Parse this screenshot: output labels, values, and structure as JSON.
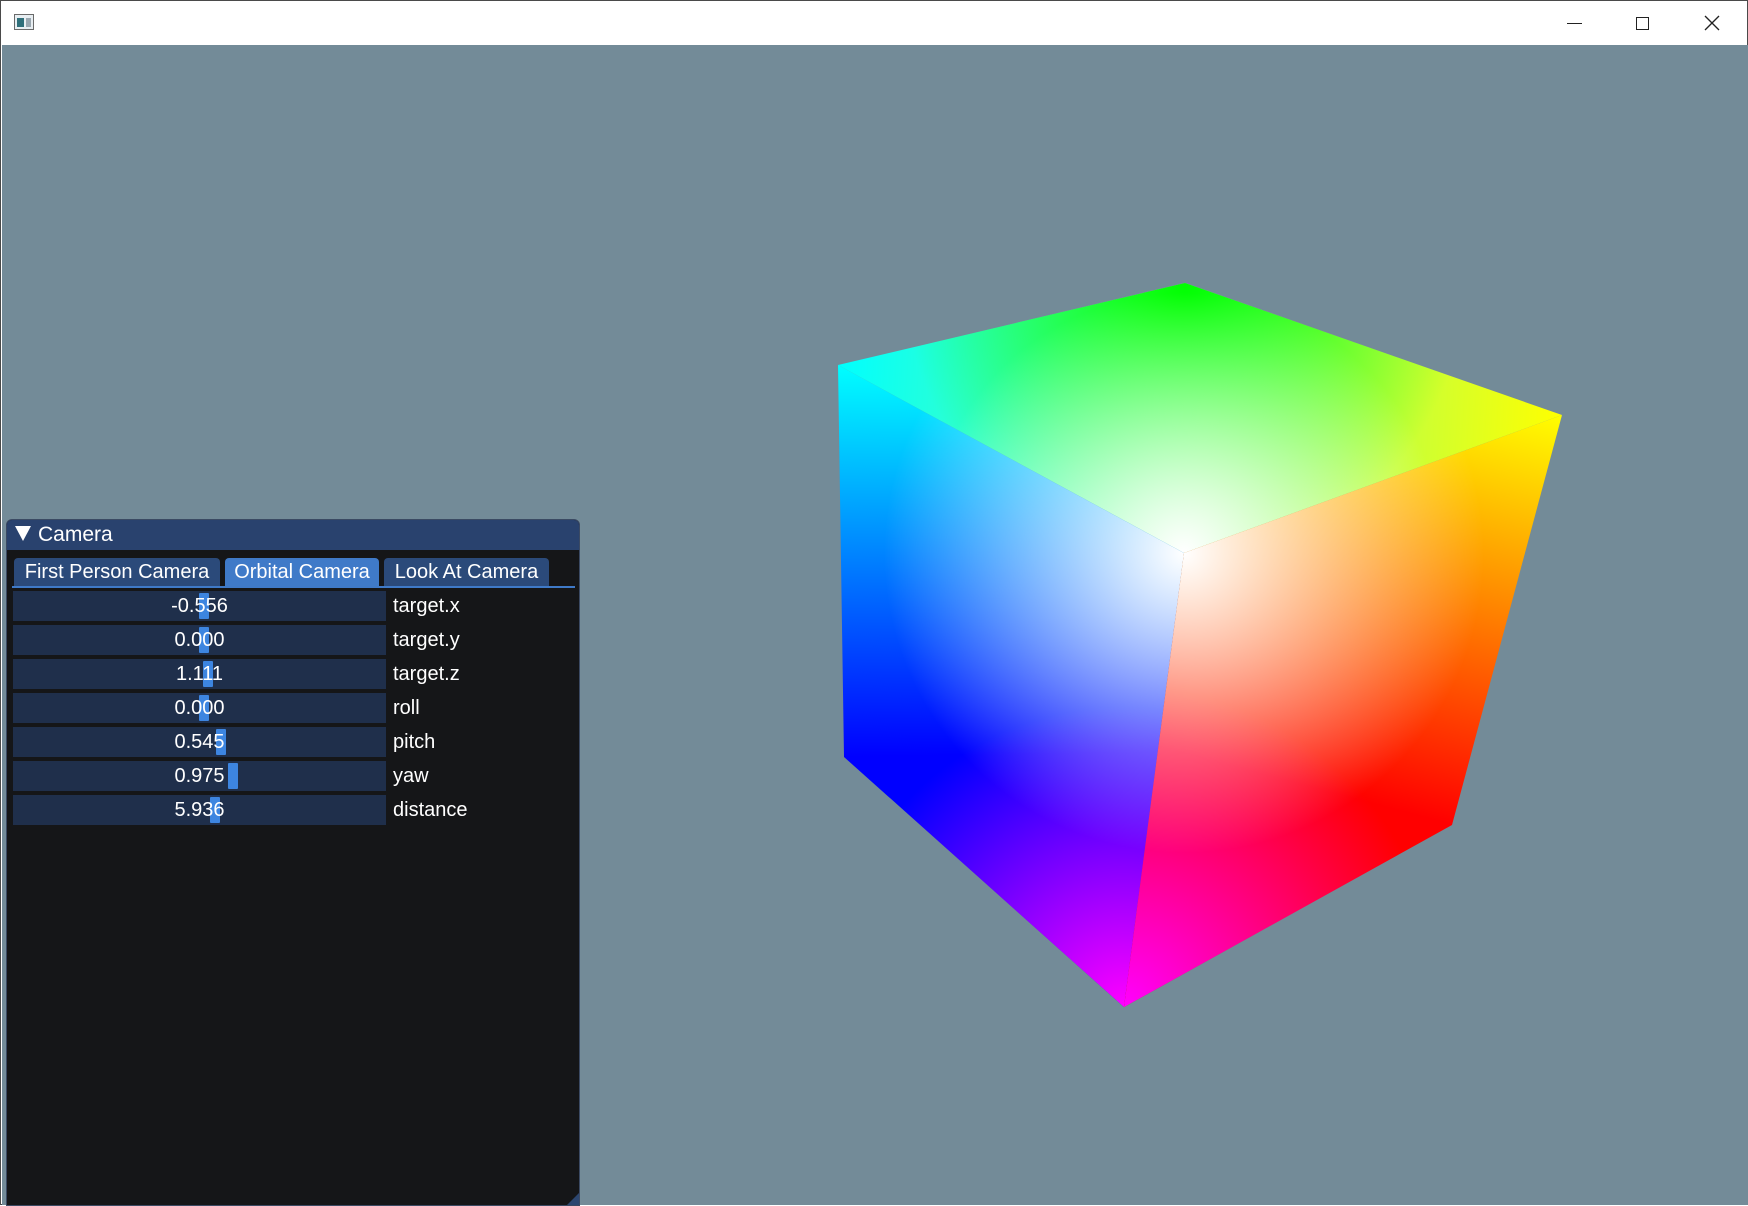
{
  "window": {
    "controls": {
      "minimize": "minimize",
      "maximize": "maximize",
      "close": "close"
    }
  },
  "viewport": {
    "background": "#738b98"
  },
  "camera_panel": {
    "title": "Camera",
    "tabs": [
      {
        "label": "First Person Camera",
        "active": false
      },
      {
        "label": "Orbital Camera",
        "active": true
      },
      {
        "label": "Look At Camera",
        "active": false
      }
    ],
    "fields": [
      {
        "label": "target.x",
        "value": "-0.556"
      },
      {
        "label": "target.y",
        "value": "0.000"
      },
      {
        "label": "target.z",
        "value": "1.111"
      },
      {
        "label": "roll",
        "value": "0.000"
      },
      {
        "label": "pitch",
        "value": "0.545"
      },
      {
        "label": "yaw",
        "value": "0.975"
      },
      {
        "label": "distance",
        "value": "5.936"
      }
    ]
  },
  "colors": {
    "accent": "#3f7ac8",
    "header": "#29426e",
    "field_bg": "#1f2f4b",
    "panel_bg": "#151618"
  }
}
